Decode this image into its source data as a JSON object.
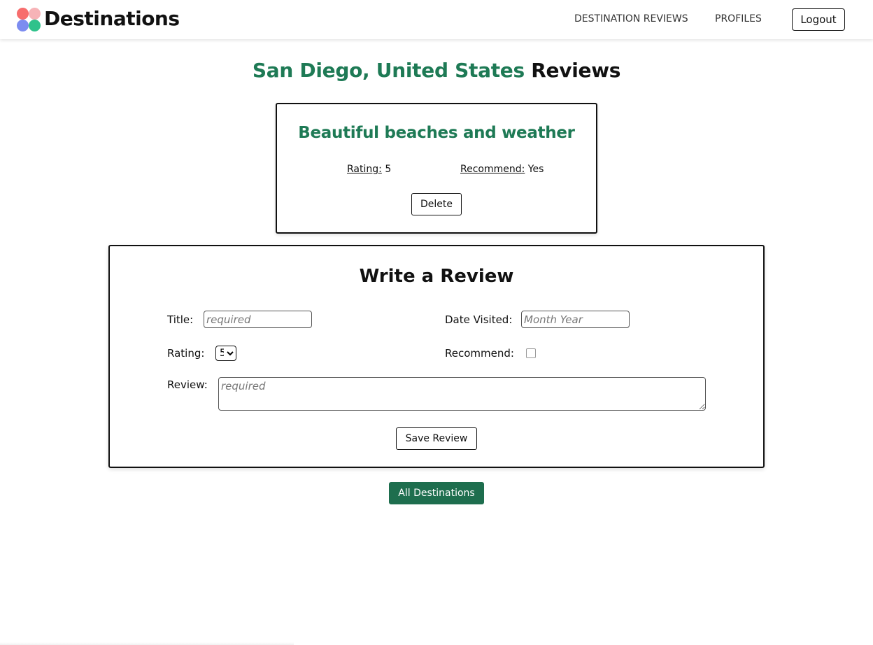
{
  "brand": {
    "name": "Destinations",
    "logo_colors": [
      "#f76d6d",
      "#f7b3b7",
      "#7c8cf0",
      "#2fc28b"
    ]
  },
  "nav": {
    "links": [
      "DESTINATION REVIEWS",
      "PROFILES"
    ],
    "logout_label": "Logout"
  },
  "page": {
    "destination": "San Diego, United States",
    "title_suffix": "Reviews"
  },
  "review": {
    "title": "Beautiful beaches and weather",
    "rating_label": "Rating:",
    "rating_value": "5",
    "recommend_label": "Recommend:",
    "recommend_value": "Yes",
    "delete_label": "Delete"
  },
  "form": {
    "heading": "Write a Review",
    "title_label": "Title:",
    "title_placeholder": "required",
    "date_label": "Date Visited:",
    "date_placeholder": "Month Year",
    "rating_label": "Rating:",
    "rating_selected": "5",
    "recommend_label": "Recommend:",
    "recommend_checked": false,
    "review_label": "Review:",
    "review_placeholder": "required",
    "save_label": "Save Review"
  },
  "footer": {
    "all_destinations_label": "All Destinations"
  },
  "colors": {
    "accent_green": "#1e7a55",
    "button_green": "#1e6e4e"
  }
}
